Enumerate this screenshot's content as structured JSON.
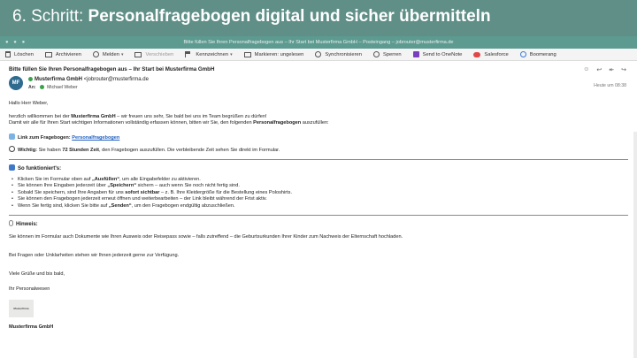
{
  "slide": {
    "prefix": "6. Schritt:",
    "title": "Personalfragebogen digital und sicher übermitteln"
  },
  "window": {
    "title": "Bitte füllen Sie Ihren Personalfragebogen aus – Ihr Start bei Musterfirma GmbH – Posteingang – jobrouter@musterfirma.de"
  },
  "toolbar": [
    {
      "label": "Löschen",
      "icon": "trash-icon"
    },
    {
      "label": "Archivieren",
      "icon": "archive-icon"
    },
    {
      "label": "Melden",
      "icon": "report-icon",
      "dropdown": true
    },
    {
      "label": "Verschieben",
      "icon": "move-icon",
      "disabled": true
    },
    {
      "label": "Kennzeichnen",
      "icon": "flag-icon",
      "dropdown": true
    },
    {
      "label": "Markieren: ungelesen",
      "icon": "mail-icon"
    },
    {
      "label": "Synchronisieren",
      "icon": "sync-icon"
    },
    {
      "label": "Sperren",
      "icon": "block-icon"
    },
    {
      "label": "Send to OneNote",
      "icon": "onenote-icon"
    },
    {
      "label": "Salesforce",
      "icon": "salesforce-icon"
    },
    {
      "label": "Boomerang",
      "icon": "boomerang-icon"
    }
  ],
  "message": {
    "subject": "Bitte füllen Sie Ihren Personalfragebogen aus – Ihr Start bei Musterfirma GmbH",
    "avatar": "MF",
    "sender_name": "Musterfirma GmbH",
    "sender_email": "<jobrouter@musterfirma.de",
    "to_label": "An:",
    "to_name": "Michael Weber",
    "time": "Heute um 08:38"
  },
  "body": {
    "greeting": "Hallo Herr Weber,",
    "intro1_a": "herzlich willkommen bei der ",
    "intro1_b": "Musterfirma GmbH",
    "intro1_c": " – wir freuen uns sehr, Sie bald bei uns im Team begrüßen zu dürfen!",
    "intro2_a": "Damit wir alle für Ihren Start wichtigen Informationen vollständig erfassen können, bitten wir Sie, den folgenden ",
    "intro2_b": "Personalfragebogen",
    "intro2_c": " auszufüllen:",
    "link_label": "Link zum Fragebogen: ",
    "link_text": "Personalfragebogen",
    "important_label": "Wichtig:",
    "important_a": " Sie haben ",
    "important_b": "72 Stunden Zeit",
    "important_c": ", den Fragebogen auszufüllen. Die verbleibende Zeit sehen Sie direkt im Formular.",
    "how_title": "So funktioniert's:",
    "steps": [
      [
        "Klicken Sie im Formular oben auf ",
        "„Ausfüllen“",
        ", um alle Eingabefelder zu aktivieren."
      ],
      [
        "Sie können Ihre Eingaben jederzeit über ",
        "„Speichern“",
        " sichern – auch wenn Sie noch nicht fertig sind."
      ],
      [
        "Sobald Sie speichern, sind Ihre Angaben für uns ",
        "sofort sichtbar",
        " – z. B. Ihre Kleidergröße für die Bestellung eines Poloshirts."
      ],
      [
        "Sie können den Fragebogen jederzeit erneut öffnen und weiterbearbeiten – der Link bleibt während der Frist aktiv.",
        "",
        ""
      ],
      [
        "Wenn Sie fertig sind, klicken Sie bitte auf ",
        "„Senden“",
        ", um den Fragebogen endgültig abzuschließen."
      ]
    ],
    "hint_title": "Hinweis:",
    "hint_text": "Sie können im Formular auch Dokumente wie Ihren Ausweis oder Reisepass sowie – falls zutreffend – die Geburtsurkunden Ihrer Kinder zum Nachweis der Elternschaft hochladen.",
    "questions": "Bei Fragen oder Unklarheiten stehen wir Ihnen jederzeit gerne zur Verfügung.",
    "closing": "Viele Grüße und bis bald,",
    "team": "Ihr Personalwesen",
    "logo_text": "Musterfirma",
    "signature": "Musterfirma GmbH"
  }
}
